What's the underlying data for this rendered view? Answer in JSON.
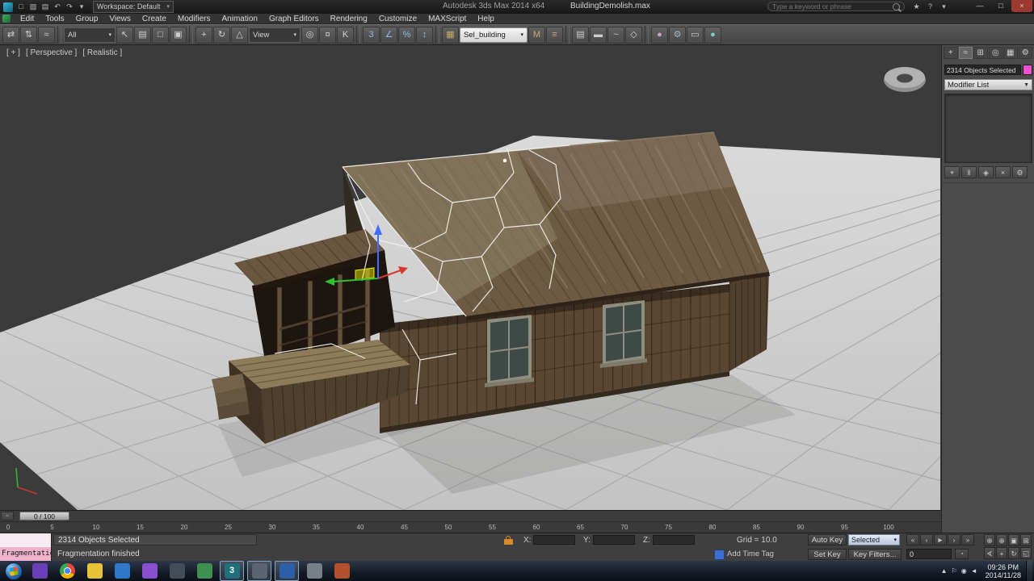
{
  "colors": {
    "accent_teal": "#35b6d9",
    "object_color_swatch": "#f14fd2",
    "listener_pink": "#efb3cc",
    "gizmo_z_blue": "#3b6eff",
    "gizmo_x_green": "#2fc12f",
    "gizmo_y_red": "#d23a2e"
  },
  "title_bar": {
    "workspace": "Workspace: Default",
    "app_title": "Autodesk 3ds Max 2014 x64",
    "doc_title": "BuildingDemolish.max",
    "search_placeholder": "Type a keyword or phrase",
    "quick_access": [
      {
        "name": "new-scene-button",
        "glyph": "□"
      },
      {
        "name": "open-file-button",
        "glyph": "▨"
      },
      {
        "name": "save-file-button",
        "glyph": "▤"
      },
      {
        "name": "undo-button",
        "glyph": "↶"
      },
      {
        "name": "redo-button",
        "glyph": "↷"
      },
      {
        "name": "qat-more-button",
        "glyph": "▾"
      }
    ],
    "help_icons": [
      {
        "name": "favorites-star-icon",
        "glyph": "★"
      },
      {
        "name": "help-icon",
        "glyph": "?"
      },
      {
        "name": "help-menu-arrow-icon",
        "glyph": "▾"
      }
    ],
    "window_controls": [
      {
        "name": "minimize-button",
        "glyph": "—"
      },
      {
        "name": "maximize-button",
        "glyph": "□"
      },
      {
        "name": "close-button",
        "glyph": "×",
        "close": true
      }
    ]
  },
  "menu_bar": {
    "items": [
      "Edit",
      "Tools",
      "Group",
      "Views",
      "Create",
      "Modifiers",
      "Animation",
      "Graph Editors",
      "Rendering",
      "Customize",
      "MAXScript",
      "Help"
    ]
  },
  "toolbar": {
    "items": [
      {
        "kind": "icon",
        "name": "select-and-link-icon",
        "glyph": "⇄"
      },
      {
        "kind": "icon",
        "name": "unlink-selection-icon",
        "glyph": "⇅"
      },
      {
        "kind": "icon",
        "name": "bind-to-spacewarp-icon",
        "glyph": "≈"
      },
      {
        "kind": "sep"
      },
      {
        "kind": "dropdown",
        "name": "selection-filter-dropdown",
        "value": "All"
      },
      {
        "kind": "icon",
        "name": "select-object-icon",
        "glyph": "↖"
      },
      {
        "kind": "icon",
        "name": "select-by-name-icon",
        "glyph": "▤"
      },
      {
        "kind": "icon",
        "name": "rectangular-selection-icon",
        "glyph": "□"
      },
      {
        "kind": "icon",
        "name": "window-crossing-icon",
        "glyph": "▣"
      },
      {
        "kind": "sep"
      },
      {
        "kind": "icon",
        "name": "select-and-move-icon",
        "glyph": "+"
      },
      {
        "kind": "icon",
        "name": "select-and-rotate-icon",
        "glyph": "↻"
      },
      {
        "kind": "icon",
        "name": "select-and-scale-icon",
        "glyph": "△"
      },
      {
        "kind": "dropdown",
        "name": "reference-coordinate-dropdown",
        "value": "View"
      },
      {
        "kind": "icon",
        "name": "use-pivot-center-icon",
        "glyph": "◎"
      },
      {
        "kind": "icon",
        "name": "select-and-manipulate-icon",
        "glyph": "¤"
      },
      {
        "kind": "icon",
        "name": "keyboard-override-icon",
        "glyph": "K"
      },
      {
        "kind": "sep"
      },
      {
        "kind": "icon",
        "name": "snaps-toggle-icon",
        "glyph": "3",
        "color": "#8fb8e8"
      },
      {
        "kind": "icon",
        "name": "angle-snap-icon",
        "glyph": "∠",
        "color": "#8fb8e8"
      },
      {
        "kind": "icon",
        "name": "percent-snap-icon",
        "glyph": "%",
        "color": "#8fb8e8"
      },
      {
        "kind": "icon",
        "name": "spinner-snap-icon",
        "glyph": "↕",
        "color": "#8fb8e8"
      },
      {
        "kind": "sep"
      },
      {
        "kind": "icon",
        "name": "edit-named-sets-icon",
        "glyph": "▦",
        "color": "#c9a86a"
      },
      {
        "kind": "dropdown",
        "name": "named-selection-dropdown",
        "value": "Sel_building",
        "light": true
      },
      {
        "kind": "icon",
        "name": "mirror-icon",
        "glyph": "M",
        "color": "#c9a86a"
      },
      {
        "kind": "icon",
        "name": "align-icon",
        "glyph": "≡",
        "color": "#c9a86a"
      },
      {
        "kind": "sep"
      },
      {
        "kind": "icon",
        "name": "layer-manager-icon",
        "glyph": "▤"
      },
      {
        "kind": "icon",
        "name": "ribbon-toggle-icon",
        "glyph": "▬"
      },
      {
        "kind": "icon",
        "name": "curve-editor-icon",
        "glyph": "~",
        "color": "#9fd09f"
      },
      {
        "kind": "icon",
        "name": "schematic-view-icon",
        "glyph": "◇"
      },
      {
        "kind": "sep"
      },
      {
        "kind": "icon",
        "name": "material-editor-icon",
        "glyph": "●",
        "color": "#d4a0c0"
      },
      {
        "kind": "icon",
        "name": "render-setup-icon",
        "glyph": "⚙",
        "color": "#9fb6c9"
      },
      {
        "kind": "icon",
        "name": "rendered-frame-icon",
        "glyph": "▭"
      },
      {
        "kind": "icon",
        "name": "render-production-icon",
        "glyph": "●",
        "color": "#7fd0c0"
      }
    ]
  },
  "viewport": {
    "nav_label": "[ + ]",
    "view_label": "[ Perspective ]",
    "shading_label": "[ Realistic ]"
  },
  "command_panel": {
    "tabs": [
      {
        "name": "create",
        "glyph": "+"
      },
      {
        "name": "modify",
        "glyph": "≈",
        "active": true
      },
      {
        "name": "hierarchy",
        "glyph": "⊞"
      },
      {
        "name": "motion",
        "glyph": "◎"
      },
      {
        "name": "display",
        "glyph": "▦"
      },
      {
        "name": "utilities",
        "glyph": "⚙"
      }
    ],
    "selection_readout": "2314 Objects Selected",
    "modifier_list_label": "Modifier List",
    "stack_buttons": [
      {
        "name": "pin-stack-button",
        "glyph": "⌖"
      },
      {
        "name": "show-end-result-button",
        "glyph": "‖"
      },
      {
        "name": "make-unique-button",
        "glyph": "◈"
      },
      {
        "name": "remove-modifier-button",
        "glyph": "×"
      },
      {
        "name": "configure-modifier-sets-button",
        "glyph": "⚙"
      }
    ]
  },
  "timeline": {
    "slider_value": "0 / 100",
    "ticks": [
      "0",
      "5",
      "10",
      "15",
      "20",
      "25",
      "30",
      "35",
      "40",
      "45",
      "50",
      "55",
      "60",
      "65",
      "70",
      "75",
      "80",
      "85",
      "90",
      "95",
      "100"
    ]
  },
  "status_bar": {
    "listener_text": "Fragmentatio",
    "selection_status": "2314 Objects Selected",
    "prompt": "Fragmentation finished",
    "coord_labels": {
      "x": "X:",
      "y": "Y:",
      "z": "Z:"
    },
    "grid_readout": "Grid = 10.0",
    "add_time_tag": "Add Time Tag",
    "auto_key_label": "Auto Key",
    "set_key_label": "Set Key",
    "key_mode_value": "Selected",
    "key_filters_label": "Key Filters...",
    "frame_field_value": "0",
    "playback": [
      {
        "name": "go-to-start-button",
        "glyph": "«"
      },
      {
        "name": "previous-frame-button",
        "glyph": "‹"
      },
      {
        "name": "play-button",
        "glyph": "►"
      },
      {
        "name": "next-frame-button",
        "glyph": "›"
      },
      {
        "name": "go-to-end-button",
        "glyph": "»"
      }
    ],
    "viewport_nav": [
      {
        "name": "zoom-button",
        "glyph": "⊕"
      },
      {
        "name": "zoom-all-button",
        "glyph": "⊕"
      },
      {
        "name": "zoom-extents-button",
        "glyph": "▣"
      },
      {
        "name": "zoom-extents-all-button",
        "glyph": "⊞"
      },
      {
        "name": "fov-button",
        "glyph": "∢"
      },
      {
        "name": "pan-button",
        "glyph": "+"
      },
      {
        "name": "orbit-button",
        "glyph": "↻"
      },
      {
        "name": "maximize-viewport-button",
        "glyph": "◱"
      }
    ]
  },
  "taskbar": {
    "clock_time": "09:26 PM",
    "clock_date": "2014/11/28",
    "icons": [
      {
        "name": "taskbar-app-1",
        "color": "#6a3fb5"
      },
      {
        "name": "taskbar-app-chrome",
        "chrome": true
      },
      {
        "name": "taskbar-app-explorer",
        "color": "#e8c33a"
      },
      {
        "name": "taskbar-app-4",
        "color": "#2e77c9"
      },
      {
        "name": "taskbar-app-5",
        "color": "#8a4fd0"
      },
      {
        "name": "taskbar-app-6",
        "color": "#444d57"
      },
      {
        "name": "taskbar-app-7",
        "color": "#3f8f4f"
      },
      {
        "name": "taskbar-app-3dsmax",
        "color": "#1f6f7d",
        "glyph": "3",
        "active": true
      },
      {
        "name": "taskbar-app-9",
        "color": "#5a6570",
        "active": true
      },
      {
        "name": "taskbar-app-10",
        "color": "#2d5fa8",
        "active": true
      },
      {
        "name": "taskbar-app-11",
        "color": "#777f88"
      },
      {
        "name": "taskbar-app-12",
        "color": "#b25030"
      }
    ],
    "tray_icons": [
      {
        "name": "tray-expand-icon",
        "glyph": "▲"
      },
      {
        "name": "tray-flag-icon",
        "glyph": "⚐"
      },
      {
        "name": "tray-network-icon",
        "glyph": "◉"
      },
      {
        "name": "tray-volume-icon",
        "glyph": "◄"
      }
    ]
  }
}
